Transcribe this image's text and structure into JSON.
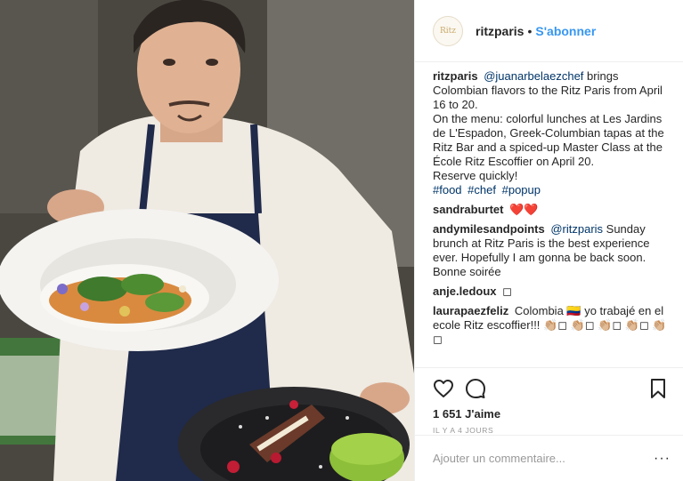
{
  "post": {
    "photo_alt": "",
    "author": {
      "username": "ritzparis",
      "avatar_text": "Ritz",
      "separator": "•",
      "follow_label": "S'abonner"
    },
    "caption": {
      "author": "ritzparis",
      "mention": "@juanarbelaezchef",
      "line1": "brings Colombian flavors to the Ritz Paris from April 16 to 20.",
      "line2": "On the menu: colorful lunches at Les Jardins de L'Espadon, Greek-Columbian tapas at the Ritz Bar and a spiced-up Master Class at the École Ritz Escoffier on April 20.",
      "line3": "Reserve quickly!",
      "hashtags": [
        "#food",
        "#chef",
        "#popup"
      ]
    },
    "comments": [
      {
        "author": "sandraburtet",
        "text": "❤️❤️"
      },
      {
        "author": "andymilesandpoints",
        "mention": "@ritzparis",
        "text": "Sunday brunch at Ritz Paris is the best experience ever. Hopefully I am gonna be back soon. Bonne soirée"
      },
      {
        "author": "anje.ledoux",
        "text": "◻"
      },
      {
        "author": "laurapaezfeliz",
        "text": "Colombia 🇨🇴 yo trabajé en el ecole Ritz escoffier!!! 👏🏼◻ 👏🏼◻ 👏🏼◻ 👏🏼◻ 👏🏼◻"
      }
    ],
    "icons": {
      "like": "heart-icon",
      "comment": "comment-icon",
      "save": "bookmark-icon",
      "more": "more-icon"
    },
    "likes": "1 651 J'aime",
    "timestamp": "IL Y A 4 JOURS",
    "add_comment_placeholder": "Ajouter un commentaire...",
    "more_label": "···",
    "colors": {
      "link": "#003569",
      "follow": "#3897f0",
      "text": "#262626",
      "muted": "#999999",
      "divider": "#efefef"
    }
  }
}
